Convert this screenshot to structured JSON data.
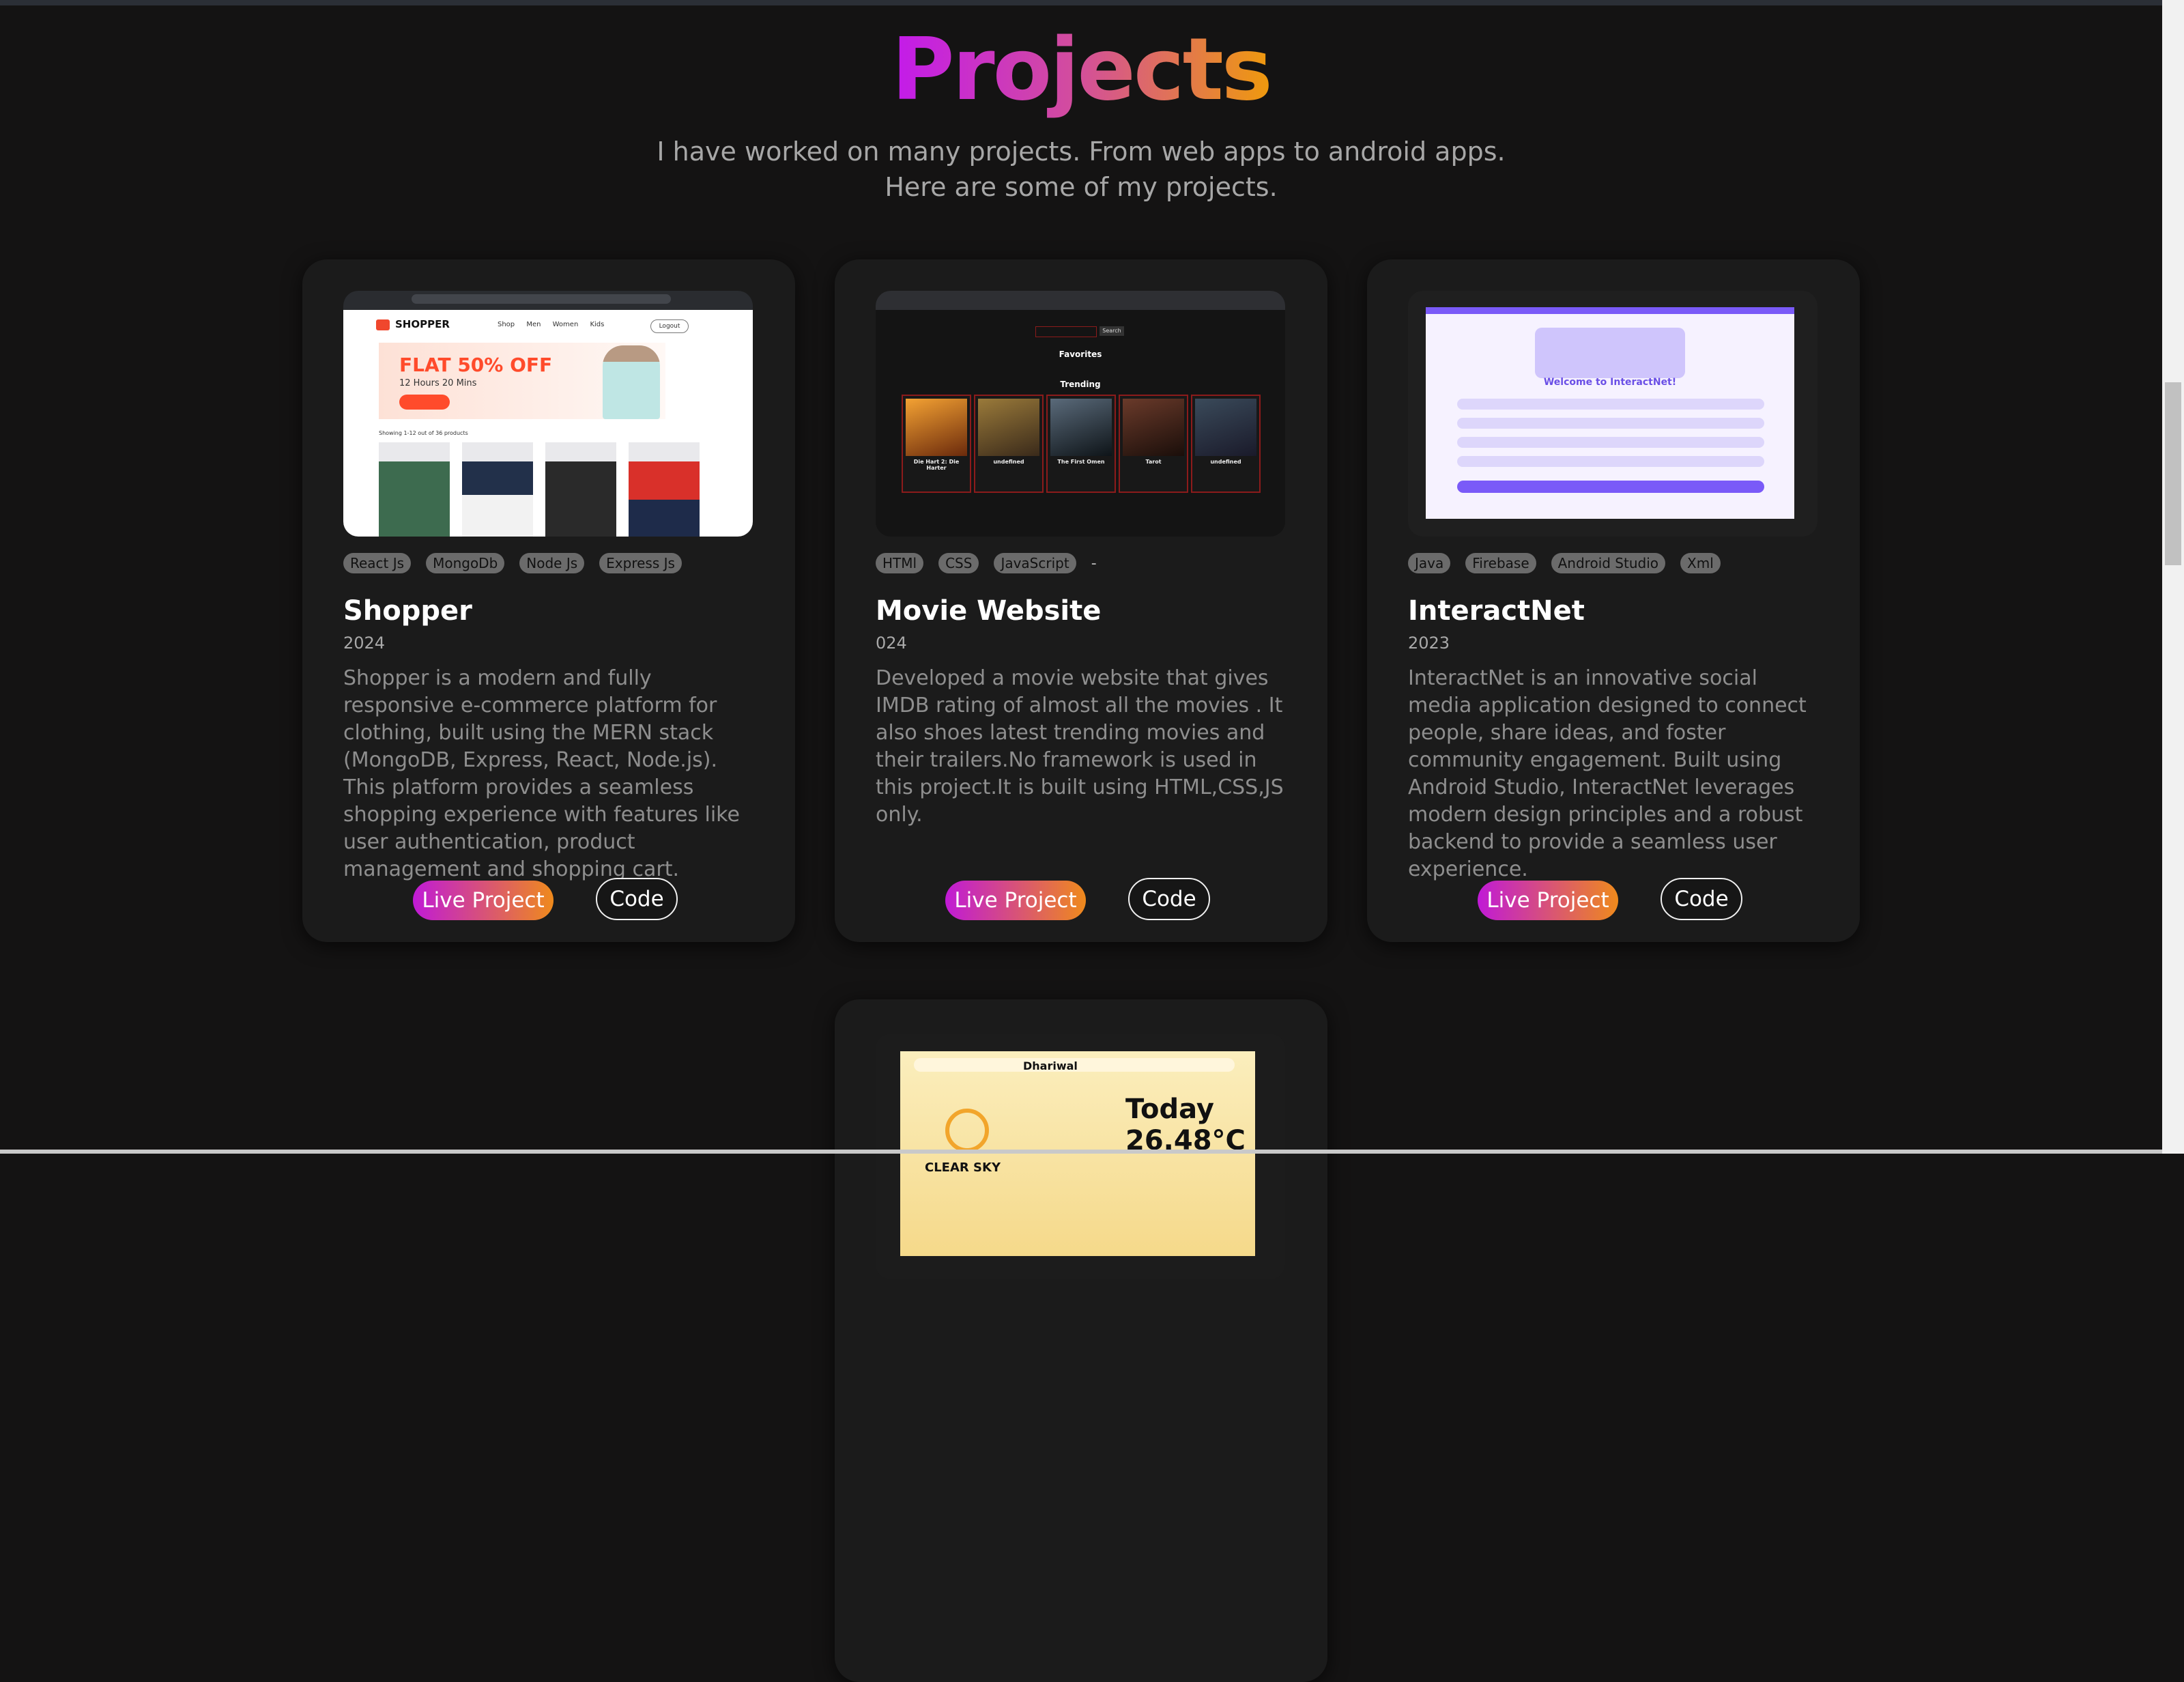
{
  "header": {
    "title": "Projects",
    "subtitle_line1": "I have worked on many projects. From web apps to android apps.",
    "subtitle_line2": "Here are some of my projects."
  },
  "projects": [
    {
      "title": "Shopper",
      "year": "2024",
      "tags": [
        "React Js",
        "MongoDb",
        "Node Js",
        "Express Js"
      ],
      "description": "Shopper is a modern and fully responsive e-commerce platform for clothing, built using the MERN stack (MongoDB, Express, React, Node.js). This platform provides a seamless shopping experience with features like user authentication, product management and shopping cart.",
      "live_label": "Live Project",
      "code_label": "Code",
      "preview": {
        "brand": "SHOPPER",
        "nav": "Shop Men Women Kids",
        "logout": "Logout",
        "banner_title": "FLAT 50% OFF",
        "banner_sub": "12 Hours 20 Mins",
        "showing": "Showing 1-12 out of 36 products"
      }
    },
    {
      "title": "Movie Website",
      "year": "024",
      "tags": [
        "HTMl",
        "CSS",
        "JavaScript"
      ],
      "tags_more": "-",
      "description": "Developed a movie website that gives IMDB rating of almost all the movies . It also shoes latest trending movies and their trailers.No framework is used in this project.It is built using HTML,CSS,JS only.",
      "live_label": "Live Project",
      "code_label": "Code",
      "preview": {
        "search_label": "Search",
        "favorites": "Favorites",
        "trending": "Trending",
        "posters": [
          "Die Hart 2: Die Harter",
          "undefined",
          "The First Omen",
          "Tarot",
          "undefined"
        ]
      }
    },
    {
      "title": "InteractNet",
      "year": "2023",
      "tags": [
        "Java",
        "Firebase",
        "Android Studio",
        "Xml"
      ],
      "description": "InteractNet is an innovative social media application designed to connect people, share ideas, and foster community engagement. Built using Android Studio, InteractNet leverages modern design principles and a robust backend to provide a seamless user experience.",
      "live_label": "Live Project",
      "code_label": "Code",
      "preview": {
        "welcome": "Welcome to InteractNet!"
      }
    },
    {
      "preview": {
        "location": "Dhariwal",
        "day": "Today",
        "temperature": "26.48°C",
        "condition": "CLEAR SKY"
      }
    }
  ],
  "colors": {
    "background": "#141313",
    "card": "#1b1b1b",
    "gradient_start": "#c31aeb",
    "gradient_end": "#ef9a0c",
    "tag_bg": "#6b6b6b"
  }
}
